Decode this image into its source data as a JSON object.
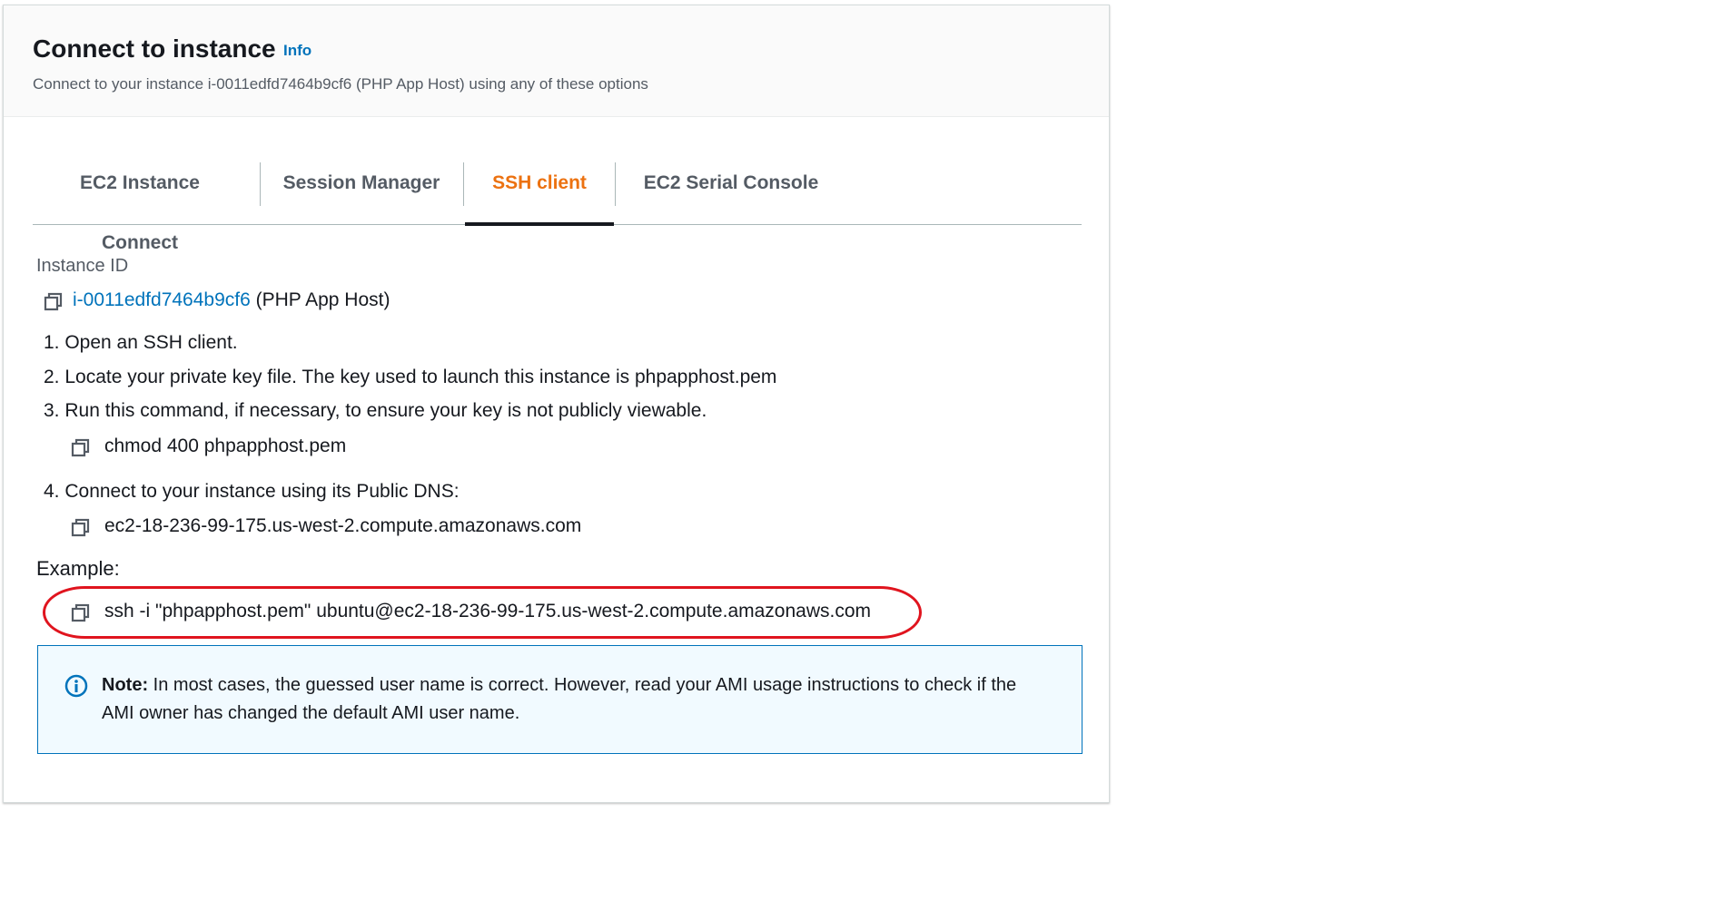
{
  "header": {
    "title": "Connect to instance",
    "info_link": "Info",
    "subtitle": "Connect to your instance i-0011edfd7464b9cf6 (PHP App Host) using any of these options"
  },
  "tabs": [
    {
      "label": "EC2 Instance Connect",
      "active": false
    },
    {
      "label": "Session Manager",
      "active": false
    },
    {
      "label": "SSH client",
      "active": true
    },
    {
      "label": "EC2 Serial Console",
      "active": false
    }
  ],
  "instance": {
    "label": "Instance ID",
    "id": "i-0011edfd7464b9cf6",
    "name": "(PHP App Host)"
  },
  "steps": [
    "1. Open an SSH client.",
    "2. Locate your private key file. The key used to launch this instance is phpapphost.pem",
    "3. Run this command, if necessary, to ensure your key is not publicly viewable.",
    "4. Connect to your instance using its Public DNS:"
  ],
  "commands": {
    "chmod": "chmod 400 phpapphost.pem",
    "public_dns": "ec2-18-236-99-175.us-west-2.compute.amazonaws.com"
  },
  "example": {
    "label": "Example:",
    "command": "ssh -i \"phpapphost.pem\" ubuntu@ec2-18-236-99-175.us-west-2.compute.amazonaws.com"
  },
  "note": {
    "prefix": "Note:",
    "text": " In most cases, the guessed user name is correct. However, read your AMI usage instructions to check if the AMI owner has changed the default AMI user name."
  },
  "colors": {
    "accent_orange": "#ec7211",
    "link_blue": "#0073bb",
    "highlight_red": "#e0141e",
    "note_bg": "#f1faff"
  },
  "icons": {
    "copy": "copy-icon",
    "info": "info-circle-icon"
  }
}
